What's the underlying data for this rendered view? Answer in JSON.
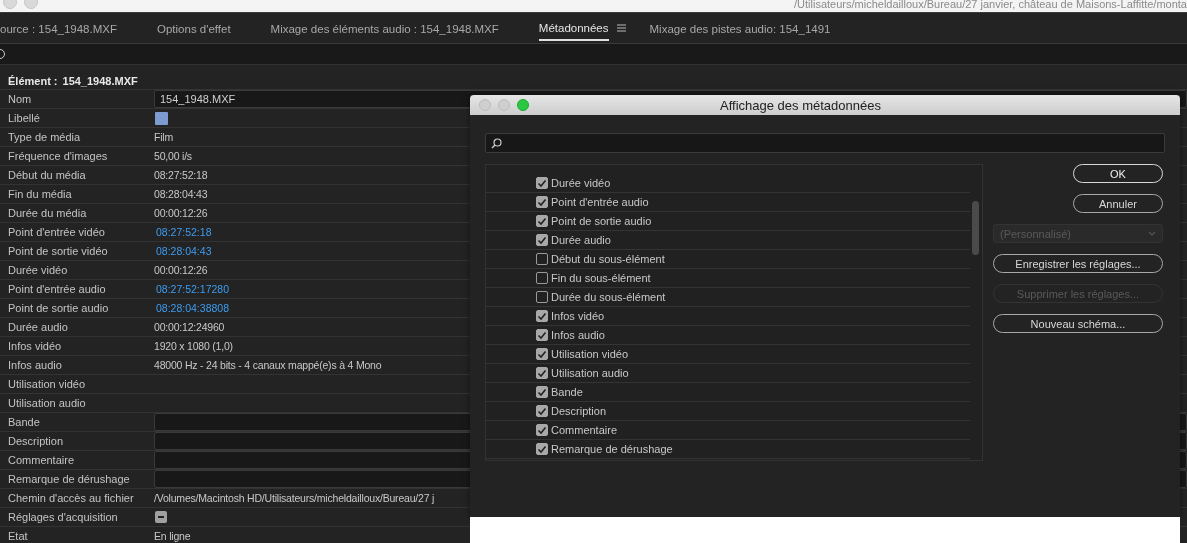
{
  "window": {
    "path": "/Utilisateurs/micheldailloux/Bureau/27 janvier, château de Maisons-Laffitte/monta"
  },
  "tabs": [
    {
      "label": "ource : 154_1948.MXF",
      "selected": false
    },
    {
      "label": "Options d'effet",
      "selected": false
    },
    {
      "label": "Mixage des éléments audio : 154_1948.MXF",
      "selected": false
    },
    {
      "label": "Métadonnées",
      "selected": true
    },
    {
      "label": "Mixage des pistes audio: 154_1491",
      "selected": false
    }
  ],
  "element": {
    "label": "Élément :",
    "value": "154_1948.MXF"
  },
  "rows": [
    {
      "label": "Nom",
      "kind": "field",
      "value": "154_1948.MXF"
    },
    {
      "label": "Libellé",
      "kind": "swatch",
      "color": "#7b9bd1"
    },
    {
      "label": "Type de média",
      "kind": "text",
      "value": "Film"
    },
    {
      "label": "Fréquence d'images",
      "kind": "text",
      "value": "50,00 i/s"
    },
    {
      "label": "Début du média",
      "kind": "text",
      "value": "08:27:52:18"
    },
    {
      "label": "Fin du média",
      "kind": "text",
      "value": "08:28:04:43"
    },
    {
      "label": "Durée du média",
      "kind": "text",
      "value": "00:00:12:26"
    },
    {
      "label": "Point d'entrée vidéo",
      "kind": "link",
      "value": "08:27:52:18"
    },
    {
      "label": "Point de sortie vidéo",
      "kind": "link",
      "value": "08:28:04:43"
    },
    {
      "label": "Durée vidéo",
      "kind": "text",
      "value": "00:00:12:26"
    },
    {
      "label": "Point d'entrée audio",
      "kind": "link",
      "value": "08:27:52:17280"
    },
    {
      "label": "Point de sortie audio",
      "kind": "link",
      "value": "08:28:04:38808"
    },
    {
      "label": "Durée audio",
      "kind": "text",
      "value": "00:00:12:24960"
    },
    {
      "label": "Infos vidéo",
      "kind": "text",
      "value": "1920 x 1080 (1,0)"
    },
    {
      "label": "Infos audio",
      "kind": "text",
      "value": "48000 Hz - 24 bits - 4 canaux mappé(e)s à 4 Mono"
    },
    {
      "label": "Utilisation vidéo",
      "kind": "empty"
    },
    {
      "label": "Utilisation audio",
      "kind": "empty"
    },
    {
      "label": "Bande",
      "kind": "field"
    },
    {
      "label": "Description",
      "kind": "field"
    },
    {
      "label": "Commentaire",
      "kind": "field"
    },
    {
      "label": "Remarque de dérushage",
      "kind": "field"
    },
    {
      "label": "Chemin d'accès au fichier",
      "kind": "text",
      "value": "/Volumes/Macintosh HD/Utilisateurs/micheldailloux/Bureau/27 j"
    },
    {
      "label": "Réglages d'acquisition",
      "kind": "toggle"
    },
    {
      "label": "Etat",
      "kind": "text",
      "value": "En ligne"
    }
  ],
  "dialog": {
    "title": "Affichage des métadonnées",
    "items": [
      {
        "label": "Durée vidéo",
        "checked": true
      },
      {
        "label": "Point d'entrée audio",
        "checked": true
      },
      {
        "label": "Point de sortie audio",
        "checked": true
      },
      {
        "label": "Durée audio",
        "checked": true
      },
      {
        "label": "Début du sous-élément",
        "checked": false
      },
      {
        "label": "Fin du sous-élément",
        "checked": false
      },
      {
        "label": "Durée du sous-élément",
        "checked": false
      },
      {
        "label": "Infos vidéo",
        "checked": true
      },
      {
        "label": "Infos audio",
        "checked": true
      },
      {
        "label": "Utilisation vidéo",
        "checked": true
      },
      {
        "label": "Utilisation audio",
        "checked": true
      },
      {
        "label": "Bande",
        "checked": true
      },
      {
        "label": "Description",
        "checked": true
      },
      {
        "label": "Commentaire",
        "checked": true
      },
      {
        "label": "Remarque de dérushage",
        "checked": true
      }
    ],
    "buttons": [
      {
        "label": "OK",
        "kind": "default",
        "disabled": false
      },
      {
        "label": "Annuler",
        "kind": "small",
        "disabled": false
      },
      {
        "label": "(Personnalisé)",
        "kind": "dropdown",
        "disabled": true
      },
      {
        "label": "Enregistrer les réglages...",
        "kind": "wide",
        "disabled": false
      },
      {
        "label": "Supprimer les réglages...",
        "kind": "wide",
        "disabled": true
      },
      {
        "label": "Nouveau schéma...",
        "kind": "wide",
        "disabled": false
      }
    ]
  }
}
